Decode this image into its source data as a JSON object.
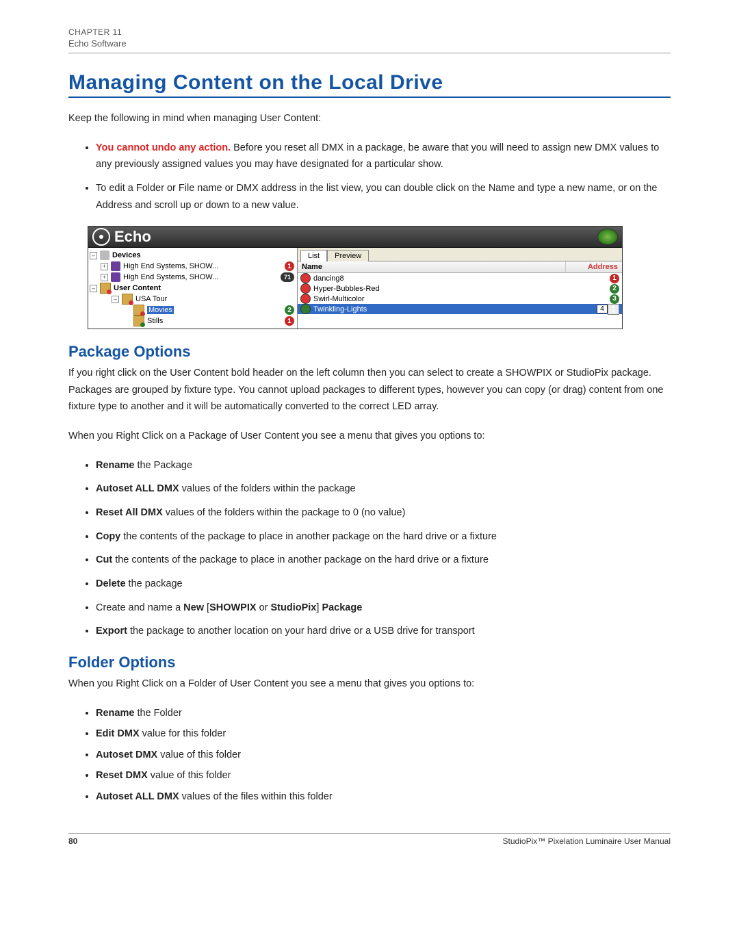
{
  "header": {
    "chapter": "CHAPTER 11",
    "breadcrumb": "Echo Software"
  },
  "title": "Managing Content on the Local Drive",
  "intro": "Keep the following in mind when managing User Content:",
  "bullets_top": {
    "b1_warn": "You cannot undo any action.",
    "b1_rest": " Before you reset all DMX in a package, be aware that you will need to assign new DMX values to any previously assigned values you may have designated for a particular show.",
    "b2": "To edit a Folder or File name or DMX address in the list view, you can double click on the Name and type a new name, or on the Address and scroll up or down to a new value."
  },
  "screenshot": {
    "app_title": "Echo",
    "tree": {
      "root": "Devices",
      "dev1": "High End Systems, SHOW...",
      "dev1_badge": "1",
      "dev2": "High End Systems, SHOW...",
      "dev2_badge": "71",
      "user_content": "User Content",
      "pkg": "USA Tour",
      "folder_movies": "Movies",
      "movies_badge": "2",
      "folder_stills": "Stills",
      "stills_badge": "1"
    },
    "tabs": {
      "list": "List",
      "preview": "Preview"
    },
    "columns": {
      "name": "Name",
      "address": "Address"
    },
    "rows": {
      "r1": "dancing8",
      "r1_badge": "1",
      "r2": "Hyper-Bubbles-Red",
      "r2_badge": "2",
      "r3": "Swirl-Multicolor",
      "r3_badge": "3",
      "r4": "Twinkling-Lights",
      "r4_edit": "4"
    }
  },
  "pkg": {
    "heading": "Package Options",
    "p1": "If you right click on the User Content bold header on the left column then you can select to create a SHOWPIX or StudioPix package.  Packages are grouped by fixture type.  You cannot upload packages to different types, however you can copy (or drag) content from one fixture type to another and it will be automatically converted to the correct LED array.",
    "p2": "When you Right Click on a Package of User Content you see a menu that gives you options to:",
    "items": {
      "i1_b": "Rename",
      "i1_r": " the Package",
      "i2_b": "Autoset ALL DMX",
      "i2_r": " values of the folders within the package",
      "i3_b": "Reset All DMX",
      "i3_r": " values of the folders within the package to 0 (no value)",
      "i4_b": "Copy",
      "i4_r": " the contents of the package to place in another package on the hard drive or a fixture",
      "i5_b": "Cut",
      "i5_r": " the contents of the package to place in another package on the hard drive or a fixture",
      "i6_b": "Delete",
      "i6_r": " the package",
      "i7_pre": "Create and name a ",
      "i7_b1": "New",
      "i7_mid": " [",
      "i7_b2": "SHOWPIX",
      "i7_or": " or ",
      "i7_b3": "StudioPix",
      "i7_close": "] ",
      "i7_b4": "Package",
      "i8_b": "Export",
      "i8_r": " the package to another location on your hard drive or a USB drive for transport"
    }
  },
  "folder": {
    "heading": "Folder Options",
    "p1": "When you Right Click on a Folder of User Content you see a menu that gives you options to:",
    "items": {
      "i1_b": "Rename",
      "i1_r": " the Folder",
      "i2_b": "Edit DMX",
      "i2_r": " value for this folder",
      "i3_b": "Autoset DMX",
      "i3_r": " value of this folder",
      "i4_b": "Reset DMX",
      "i4_r": " value of this folder",
      "i5_b": "Autoset ALL DMX",
      "i5_r": " values of the files within this folder"
    }
  },
  "footer": {
    "page": "80",
    "doc": "StudioPix™ Pixelation Luminaire User Manual"
  }
}
